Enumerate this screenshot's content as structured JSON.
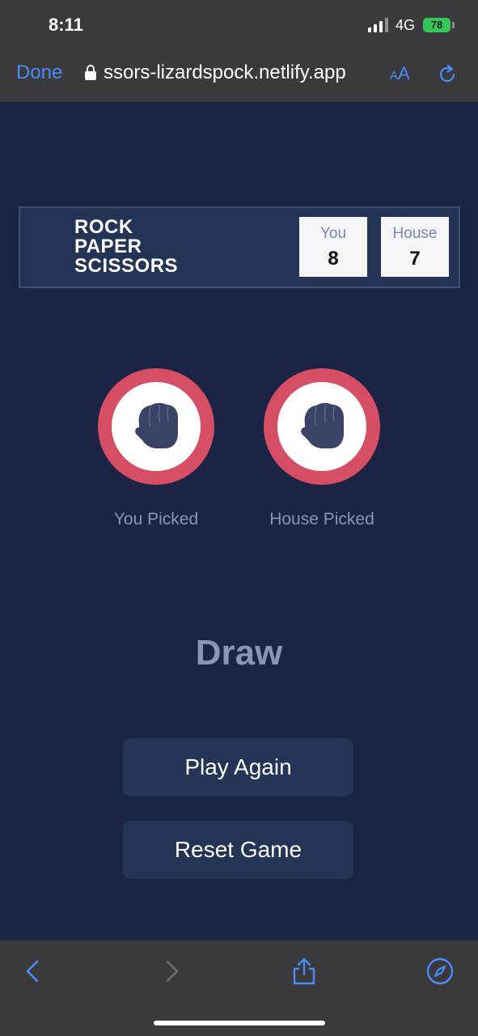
{
  "status_bar": {
    "time": "8:11",
    "network": "4G",
    "battery": "78"
  },
  "browser": {
    "done_label": "Done",
    "url": "ssors-lizardspock.netlify.app",
    "text_size_small": "A",
    "text_size_large": "A",
    "accent_color": "#4a8df6"
  },
  "header": {
    "logo_lines": [
      "ROCK",
      "PAPER",
      "SCISSORS"
    ],
    "score_you_label": "You",
    "score_you_value": "8",
    "score_house_label": "House",
    "score_house_value": "7"
  },
  "picks": {
    "you_label": "You Picked",
    "you_choice_icon": "rock-fist-icon",
    "house_label": "House Picked",
    "house_choice_icon": "rock-fist-icon",
    "ring_color": "#d64e63"
  },
  "result": {
    "text": "Draw"
  },
  "actions": {
    "play_again": "Play Again",
    "reset": "Reset Game"
  },
  "toolbar": {
    "icons": [
      "back-arrow-icon",
      "forward-arrow-icon",
      "share-icon",
      "compass-icon"
    ]
  }
}
